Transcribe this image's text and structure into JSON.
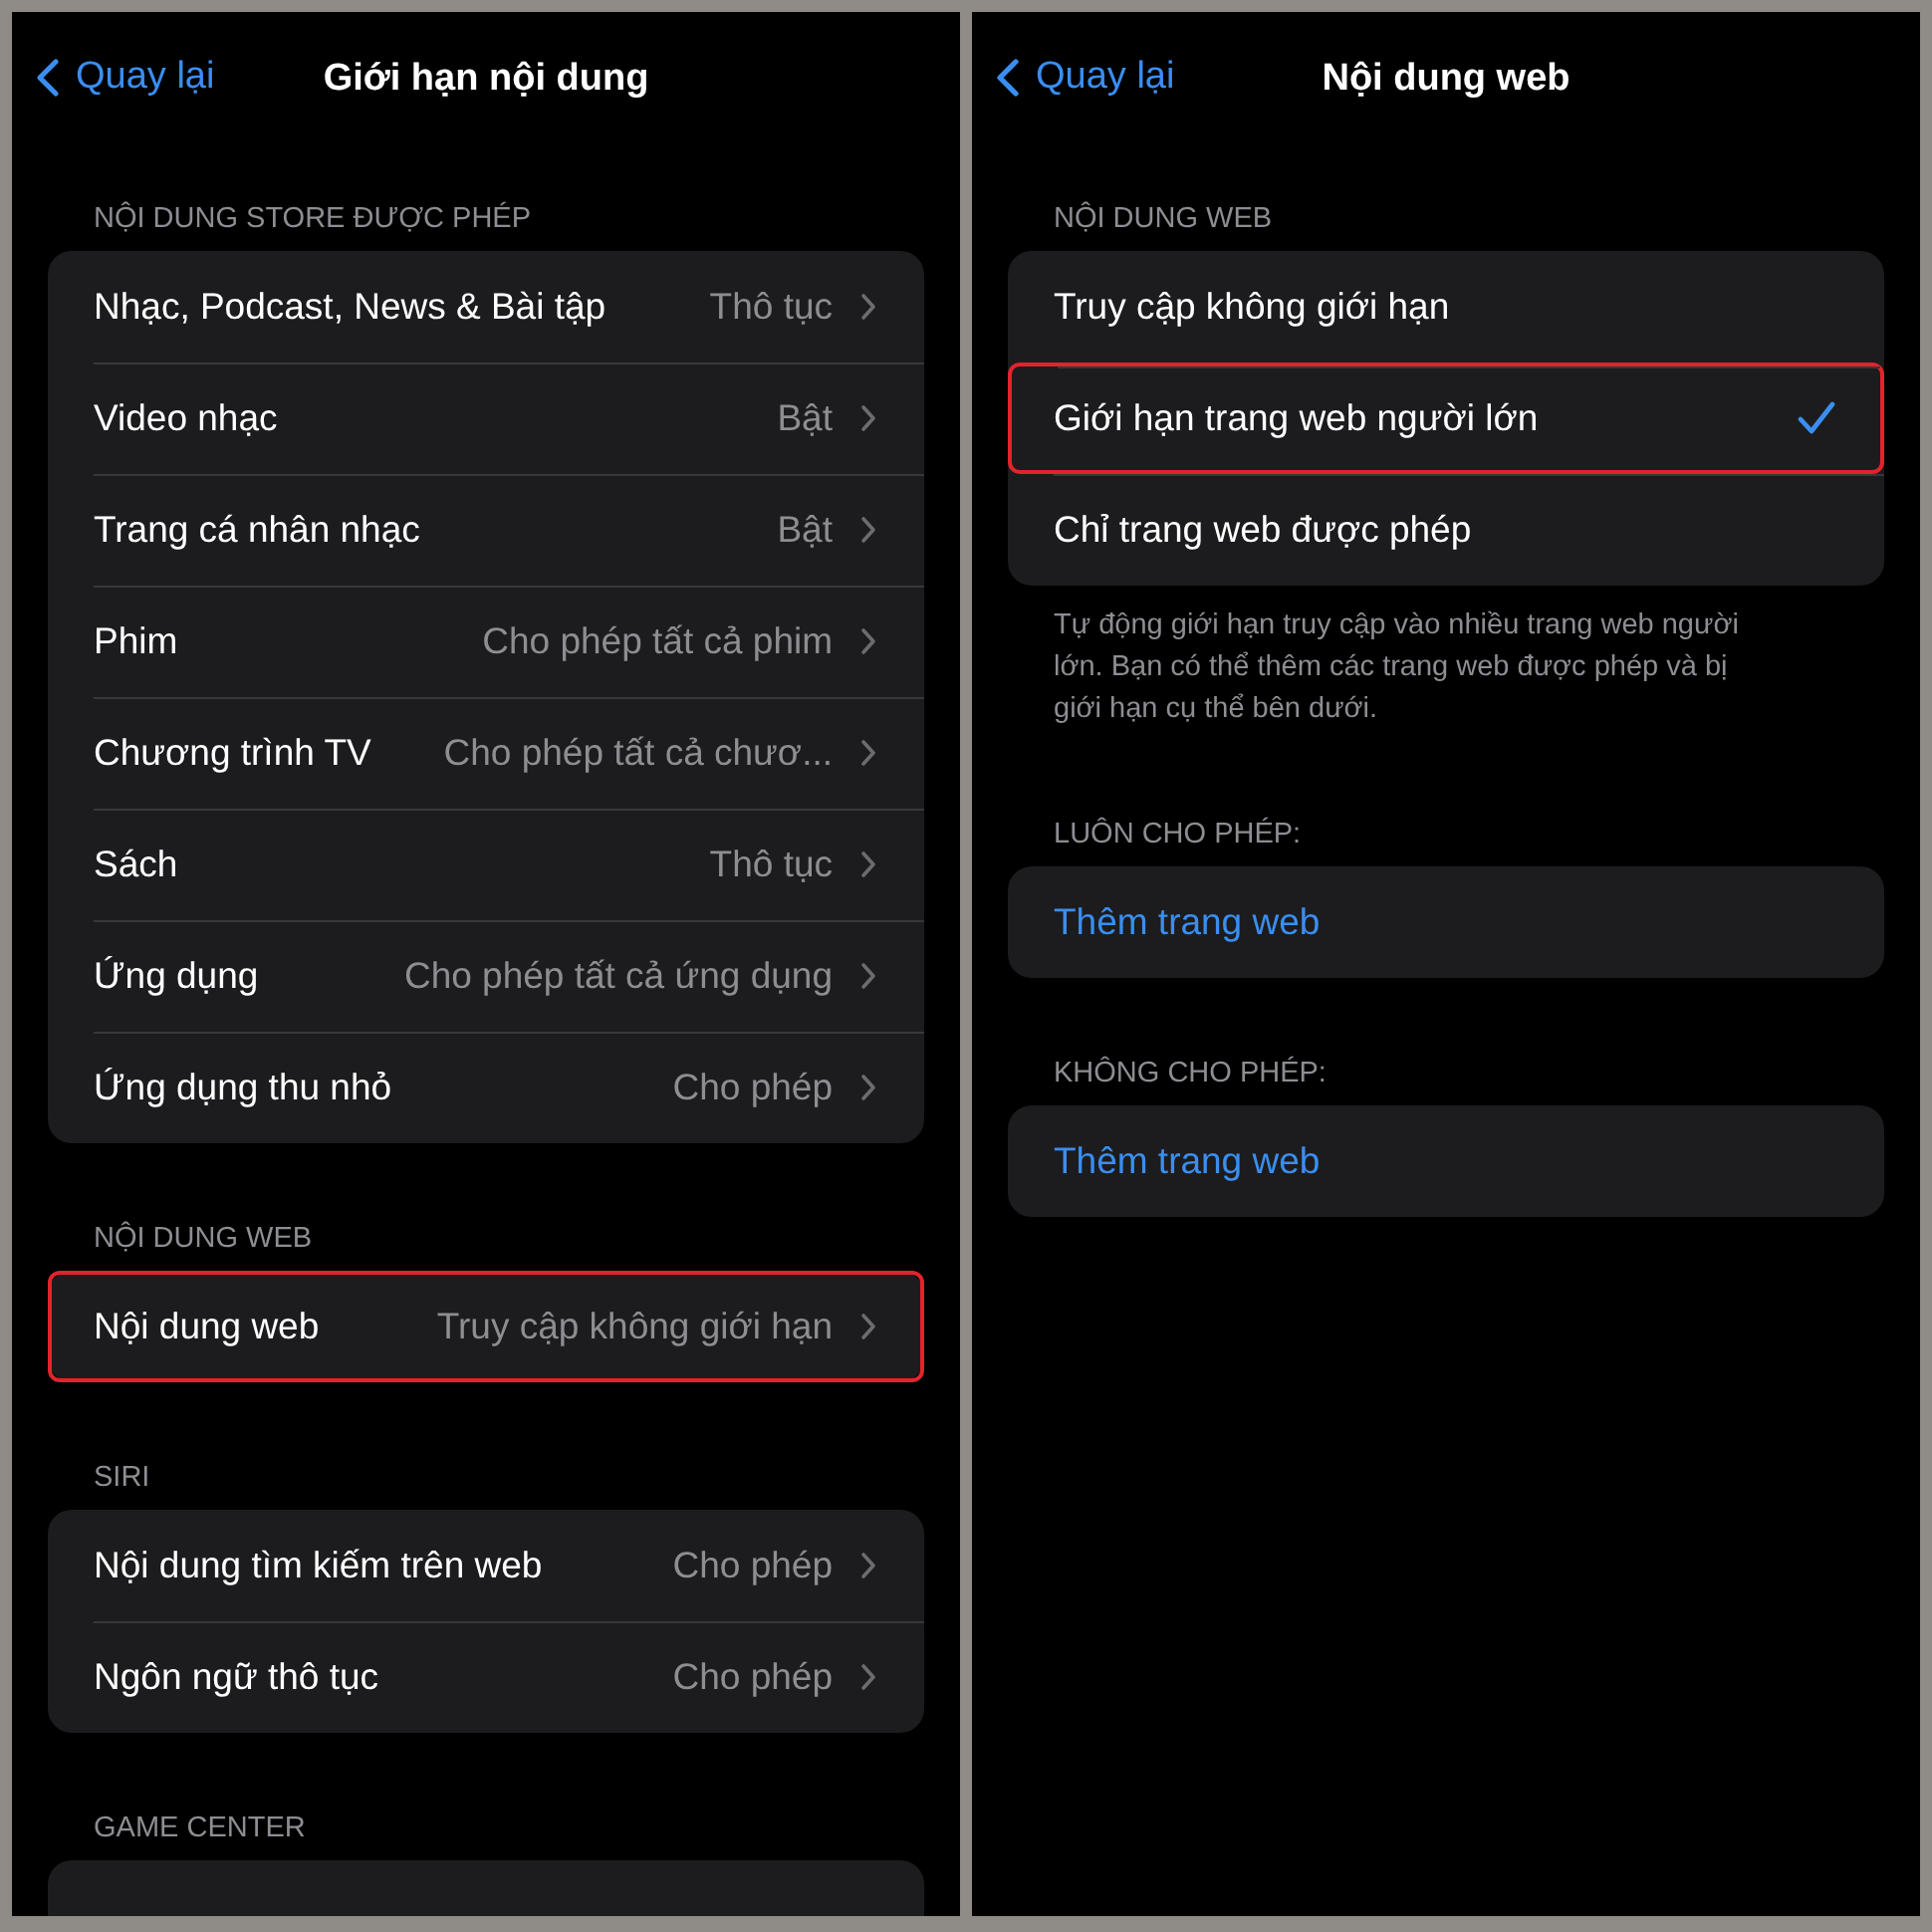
{
  "panels": [
    {
      "back": "Quay lại",
      "title": "Giới hạn nội dung",
      "sections": [
        {
          "header": "NỘI DUNG STORE ĐƯỢC PHÉP",
          "rows": [
            {
              "label": "Nhạc, Podcast, News & Bài tập",
              "value": "Thô tục",
              "highlighted": false
            },
            {
              "label": "Video nhạc",
              "value": "Bật",
              "highlighted": false
            },
            {
              "label": "Trang cá nhân nhạc",
              "value": "Bật",
              "highlighted": false
            },
            {
              "label": "Phim",
              "value": "Cho phép tất cả phim",
              "highlighted": false
            },
            {
              "label": "Chương trình TV",
              "value": "Cho phép tất cả chươ...",
              "highlighted": false
            },
            {
              "label": "Sách",
              "value": "Thô tục",
              "highlighted": false
            },
            {
              "label": "Ứng dụng",
              "value": "Cho phép tất cả ứng dụng",
              "highlighted": false
            },
            {
              "label": "Ứng dụng thu nhỏ",
              "value": "Cho phép",
              "highlighted": false
            }
          ]
        },
        {
          "header": "NỘI DUNG WEB",
          "rows": [
            {
              "label": "Nội dung web",
              "value": "Truy cập không giới hạn",
              "highlighted": true
            }
          ]
        },
        {
          "header": "SIRI",
          "rows": [
            {
              "label": "Nội dung tìm kiếm trên web",
              "value": "Cho phép",
              "highlighted": false
            },
            {
              "label": "Ngôn ngữ thô tục",
              "value": "Cho phép",
              "highlighted": false
            }
          ]
        },
        {
          "header": "GAME CENTER",
          "cut_off": true
        }
      ]
    },
    {
      "back": "Quay lại",
      "title": "Nội dung web",
      "sections": [
        {
          "header": "NỘI DUNG WEB",
          "options": [
            {
              "label": "Truy cập không giới hạn",
              "selected": false,
              "highlighted": false
            },
            {
              "label": "Giới hạn trang web người lớn",
              "selected": true,
              "highlighted": true
            },
            {
              "label": "Chỉ trang web được phép",
              "selected": false,
              "highlighted": false
            }
          ],
          "footer": "Tự động giới hạn truy cập vào nhiều trang web người lớn. Bạn có thể thêm các trang web được phép và bị giới hạn cụ thể bên dưới."
        },
        {
          "header": "LUÔN CHO PHÉP:",
          "link": "Thêm trang web"
        },
        {
          "header": "KHÔNG CHO PHÉP:",
          "link": "Thêm trang web"
        }
      ]
    }
  ]
}
